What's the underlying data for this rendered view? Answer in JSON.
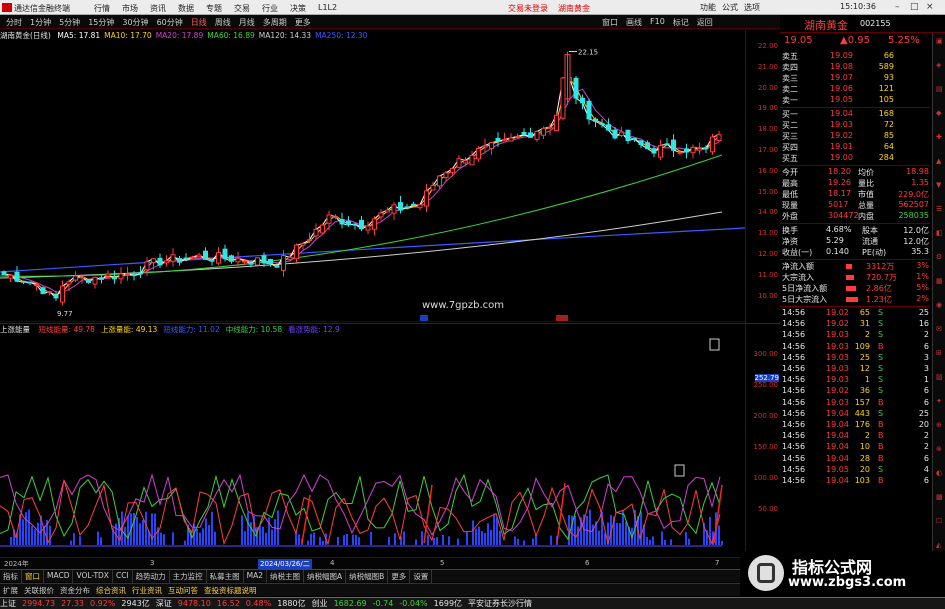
{
  "titlebar": {
    "app_title": "通达信金融终端",
    "menu": [
      "行情",
      "市场",
      "资讯",
      "数据",
      "专题",
      "交易",
      "行业",
      "决策",
      "L1L2"
    ],
    "trade_links": [
      "交易未登录",
      "湖南黄金"
    ],
    "right_items": [
      "功能",
      "公式",
      "选项"
    ],
    "clock": "15:10:36"
  },
  "toolbar": {
    "periods": [
      "分时",
      "1分钟",
      "5分钟",
      "15分钟",
      "30分钟",
      "60分钟",
      "日线",
      "周线",
      "月线",
      "多周期",
      "更多"
    ],
    "active_period": "日线",
    "tools": [
      "窗口",
      "画线",
      "F10",
      "标记",
      "返回"
    ]
  },
  "stock": {
    "name": "湖南黄金",
    "code": "002155"
  },
  "ma_line": {
    "label": "湖南黄金(日线)",
    "items": [
      {
        "text": "MA5: 17.81",
        "color": "#ffffff"
      },
      {
        "text": "MA10: 17.70",
        "color": "#ffd600"
      },
      {
        "text": "MA20: 17.89",
        "color": "#d43fd4"
      },
      {
        "text": "MA60: 16.89",
        "color": "#3dd23d"
      },
      {
        "text": "MA120: 14.33",
        "color": "#cfcfcf"
      },
      {
        "text": "MA250: 12.30",
        "color": "#3a5bff"
      }
    ]
  },
  "price_axis": [
    "22.00",
    "21.00",
    "20.00",
    "19.00",
    "18.00",
    "17.00",
    "16.00",
    "15.00",
    "14.00",
    "13.00",
    "12.00",
    "11.00",
    "10.00"
  ],
  "annotations": {
    "high": "22.15",
    "low": "9.77",
    "watermark": "www.7gpzb.com"
  },
  "indicator": {
    "name": "上涨能量",
    "items": [
      {
        "text": "短线能量: 49.78",
        "color": "#ff4040"
      },
      {
        "text": "上涨量能: 49.13",
        "color": "#ffd600"
      },
      {
        "text": "短线能力: 11.02",
        "color": "#3a5bff"
      },
      {
        "text": "中线能力: 10.58",
        "color": "#3dd23d"
      },
      {
        "text": "看涨势能: 12.9",
        "color": "#7040ff"
      }
    ],
    "axis": [
      "300.00",
      "250.00",
      "200.00",
      "150.00",
      "100.00",
      "50.00"
    ],
    "current": "252.79"
  },
  "datebar": {
    "left": "2024年",
    "selected": "2024/03/26/二",
    "marks": [
      "3",
      "4",
      "5",
      "6",
      "7"
    ]
  },
  "tabs": [
    "指标",
    "窗口",
    "MACD",
    "VOL-TDX",
    "CCI",
    "趋势动力",
    "主力监控",
    "私募主图",
    "MA2",
    "纳税主图",
    "纳税幅图A",
    "纳税幅图B",
    "更多",
    "设置"
  ],
  "tabs2": [
    "扩展",
    "关联报价",
    "资金分布",
    "综合资讯",
    "行业资讯",
    "互动问答",
    "查投资标题说明"
  ],
  "quote": {
    "price": "19.05",
    "change": "▲0.95",
    "pct": "5.25%",
    "asks": [
      {
        "label": "卖五",
        "price": "19.09",
        "vol": "66"
      },
      {
        "label": "卖四",
        "price": "19.08",
        "vol": "589"
      },
      {
        "label": "卖三",
        "price": "19.07",
        "vol": "93"
      },
      {
        "label": "卖二",
        "price": "19.06",
        "vol": "121"
      },
      {
        "label": "卖一",
        "price": "19.05",
        "vol": "105"
      }
    ],
    "bids": [
      {
        "label": "买一",
        "price": "19.04",
        "vol": "168"
      },
      {
        "label": "买二",
        "price": "19.03",
        "vol": "72"
      },
      {
        "label": "买三",
        "price": "19.02",
        "vol": "85"
      },
      {
        "label": "买四",
        "price": "19.01",
        "vol": "64"
      },
      {
        "label": "买五",
        "price": "19.00",
        "vol": "284"
      }
    ],
    "stats": [
      {
        "l1": "今开",
        "v1": "18.20",
        "l2": "均价",
        "v2": "18.98"
      },
      {
        "l1": "最高",
        "v1": "19.26",
        "l2": "量比",
        "v2": "1.35"
      },
      {
        "l1": "最低",
        "v1": "18.17",
        "l2": "市值",
        "v2": "229.0亿"
      },
      {
        "l1": "现量",
        "v1": "5017",
        "l2": "总量",
        "v2": "562507"
      },
      {
        "l1": "外盘",
        "v1": "304472",
        "l2": "内盘",
        "v2": "258035"
      }
    ],
    "stats2": [
      {
        "l1": "换手",
        "v1": "4.68%",
        "l2": "股本",
        "v2": "12.0亿"
      },
      {
        "l1": "净资",
        "v1": "5.29",
        "l2": "流通",
        "v2": "12.0亿"
      },
      {
        "l1": "收益(一)",
        "v1": "0.140",
        "l2": "PE(动)",
        "v2": "35.3"
      }
    ],
    "flows": [
      {
        "label": "净流入额",
        "value": "3312万",
        "pct": "3%"
      },
      {
        "label": "大宗流入",
        "value": "720.7万",
        "pct": "1%"
      },
      {
        "label": "5日净流入额",
        "value": "2.86亿",
        "pct": "5%"
      },
      {
        "label": "5日大宗流入",
        "value": "1.23亿",
        "pct": "2%"
      }
    ],
    "ticks": [
      {
        "t": "14:56",
        "p": "19.02",
        "v": "65",
        "d": "S",
        "n": "25"
      },
      {
        "t": "14:56",
        "p": "19.02",
        "v": "31",
        "d": "S",
        "n": "16"
      },
      {
        "t": "14:56",
        "p": "19.03",
        "v": "2",
        "d": "S",
        "n": "2"
      },
      {
        "t": "14:56",
        "p": "19.03",
        "v": "109",
        "d": "B",
        "n": "6"
      },
      {
        "t": "14:56",
        "p": "19.03",
        "v": "25",
        "d": "S",
        "n": "3"
      },
      {
        "t": "14:56",
        "p": "19.03",
        "v": "12",
        "d": "S",
        "n": "3"
      },
      {
        "t": "14:56",
        "p": "19.03",
        "v": "1",
        "d": "S",
        "n": "1"
      },
      {
        "t": "14:56",
        "p": "19.02",
        "v": "36",
        "d": "S",
        "n": "6"
      },
      {
        "t": "14:56",
        "p": "19.03",
        "v": "157",
        "d": "B",
        "n": "6"
      },
      {
        "t": "14:56",
        "p": "19.04",
        "v": "443",
        "d": "S",
        "n": "25"
      },
      {
        "t": "14:56",
        "p": "19.04",
        "v": "176",
        "d": "B",
        "n": "20"
      },
      {
        "t": "14:56",
        "p": "19.04",
        "v": "2",
        "d": "B",
        "n": "2"
      },
      {
        "t": "14:56",
        "p": "19.04",
        "v": "10",
        "d": "B",
        "n": "2"
      },
      {
        "t": "14:56",
        "p": "19.04",
        "v": "28",
        "d": "B",
        "n": "6"
      },
      {
        "t": "14:56",
        "p": "19.05",
        "v": "20",
        "d": "S",
        "n": "4"
      },
      {
        "t": "14:56",
        "p": "19.04",
        "v": "103",
        "d": "B",
        "n": "6"
      }
    ]
  },
  "statusbar": [
    {
      "text": "上证",
      "color": "#e6e6e6"
    },
    {
      "text": "2994.73",
      "color": "#ff3b3b"
    },
    {
      "text": "27.33",
      "color": "#ff3b3b"
    },
    {
      "text": "0.92%",
      "color": "#ff3b3b"
    },
    {
      "text": "2943亿",
      "color": "#e6e6e6"
    },
    {
      "text": "深证",
      "color": "#e6e6e6"
    },
    {
      "text": "9478.10",
      "color": "#ff3b3b"
    },
    {
      "text": "16.52",
      "color": "#ff3b3b"
    },
    {
      "text": "0.48%",
      "color": "#ff3b3b"
    },
    {
      "text": "1880亿",
      "color": "#e6e6e6"
    },
    {
      "text": "创业",
      "color": "#e6e6e6"
    },
    {
      "text": "1682.69",
      "color": "#3dd23d"
    },
    {
      "text": "-0.74",
      "color": "#3dd23d"
    },
    {
      "text": "-0.04%",
      "color": "#3dd23d"
    },
    {
      "text": "1699亿",
      "color": "#e6e6e6"
    },
    {
      "text": "平安证券长沙行情",
      "color": "#e6e6e6"
    }
  ],
  "watermark2": {
    "line1": "指标公式网",
    "line2": "www.zbgs3.com"
  },
  "colors": {
    "up": "#ff3b3b",
    "down": "#2fe6e6",
    "grid_line": "#600000"
  }
}
